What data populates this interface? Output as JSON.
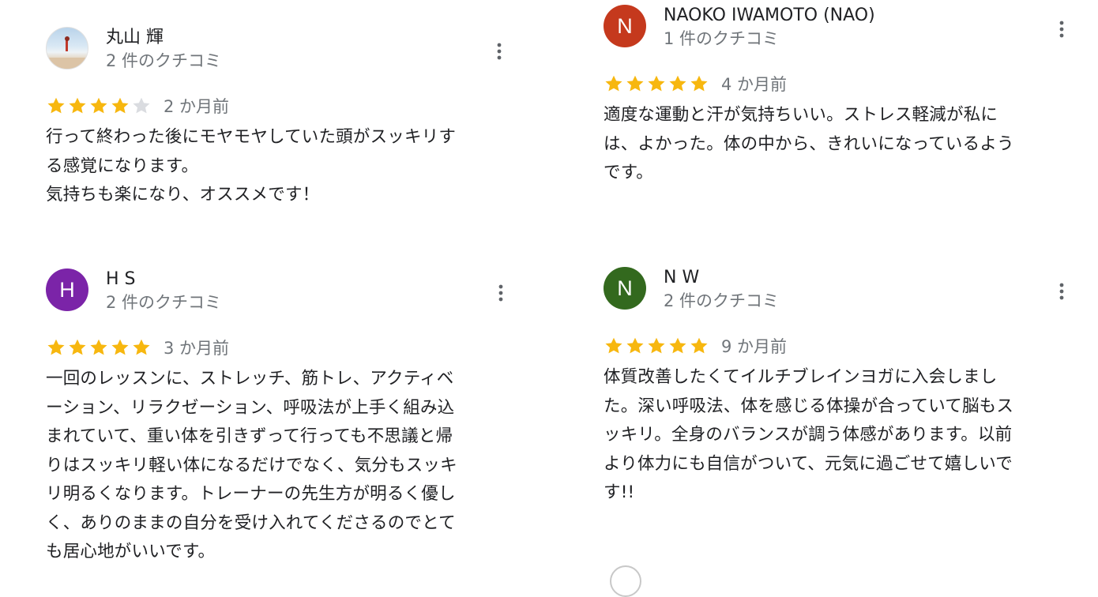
{
  "colors": {
    "star_filled": "#f7b70f",
    "star_empty": "#dadce0",
    "text_primary": "#202124",
    "text_secondary": "#70757a"
  },
  "reviews": [
    {
      "reviewer_name": "丸山 輝",
      "review_count": "2 件のクチコミ",
      "avatar_type": "photo",
      "avatar_letter": "",
      "avatar_color": "#cfe0ef",
      "rating": 4,
      "date": "2 か月前",
      "text": "行って終わった後にモヤモヤしていた頭がスッキリす\nる感覚になります。\n気持ちも楽になり、オススメです！"
    },
    {
      "reviewer_name": "NAOKO IWAMOTO (NAO)",
      "review_count": "1 件のクチコミ",
      "avatar_type": "letter",
      "avatar_letter": "N",
      "avatar_color": "#c5391d",
      "rating": 5,
      "date": "4 か月前",
      "text": "適度な運動と汗が気持ちいい。ストレス軽減が私に\nは、よかった。体の中から、きれいになっているよう\nです。"
    },
    {
      "reviewer_name": "H S",
      "review_count": "2 件のクチコミ",
      "avatar_type": "letter",
      "avatar_letter": "H",
      "avatar_color": "#7b24a8",
      "rating": 5,
      "date": "3 か月前",
      "text": "一回のレッスンに、ストレッチ、筋トレ、アクティベ\nーション、リラクゼーション、呼吸法が上手く組み込\nまれていて、重い体を引きずって行っても不思議と帰\nりはスッキリ軽い体になるだけでなく、気分もスッキ\nリ明るくなります。トレーナーの先生方が明るく優し\nく、ありのままの自分を受け入れてくださるのでとて\nも居心地がいいです。"
    },
    {
      "reviewer_name": "N W",
      "review_count": "2 件のクチコミ",
      "avatar_type": "letter",
      "avatar_letter": "N",
      "avatar_color": "#33691e",
      "rating": 5,
      "date": "9 か月前",
      "text": "体質改善したくてイルチブレインヨガに入会しまし\nた。深い呼吸法、体を感じる体操が合っていて脳もス\nッキリ。全身のバランスが調う体感があります。以前\nより体力にも自信がついて、元気に過ごせて嬉しいで\nす!!"
    }
  ]
}
